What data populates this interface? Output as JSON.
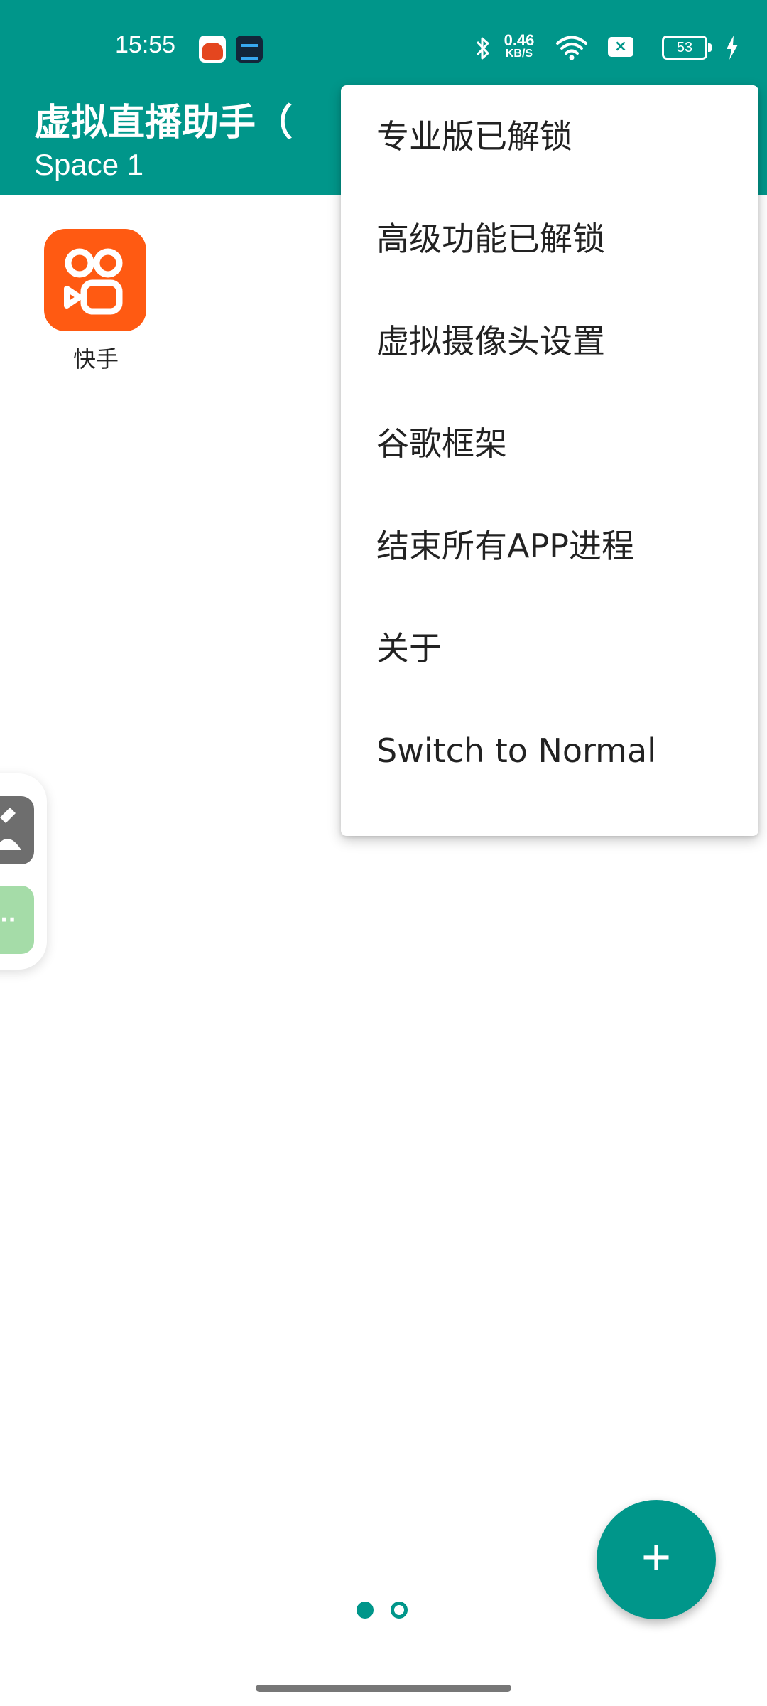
{
  "status_bar": {
    "time": "15:55",
    "notification_icons": [
      "game-app-icon",
      "screen-app-icon"
    ],
    "network_speed_value": "0.46",
    "network_speed_unit": "KB/S",
    "battery_level": "53",
    "icons": [
      "bluetooth-icon",
      "wifi-icon",
      "sim-no-signal-icon",
      "battery-icon",
      "charging-icon"
    ]
  },
  "toolbar": {
    "title": "虚拟直播助手（",
    "subtitle": "Space 1"
  },
  "apps": [
    {
      "label": "快手",
      "icon": "kuaishou-app-icon"
    }
  ],
  "side_tools": {
    "icons": [
      "tools-icon",
      "more-icon"
    ]
  },
  "menu": {
    "items": [
      {
        "label": "专业版已解锁"
      },
      {
        "label": "高级功能已解锁"
      },
      {
        "label": "虚拟摄像头设置"
      },
      {
        "label": "谷歌框架"
      },
      {
        "label": "结束所有APP进程"
      },
      {
        "label": "关于"
      },
      {
        "label": "Switch to Normal"
      }
    ]
  },
  "pager": {
    "page_count": 2,
    "active_page": 1
  },
  "fab": {
    "label": "+"
  },
  "colors": {
    "primary": "#00968a",
    "app_icon_bg": "#ff5a12",
    "menu_text": "#222222",
    "more_button": "#a5dca8",
    "tools_button": "#6e6e6e"
  }
}
